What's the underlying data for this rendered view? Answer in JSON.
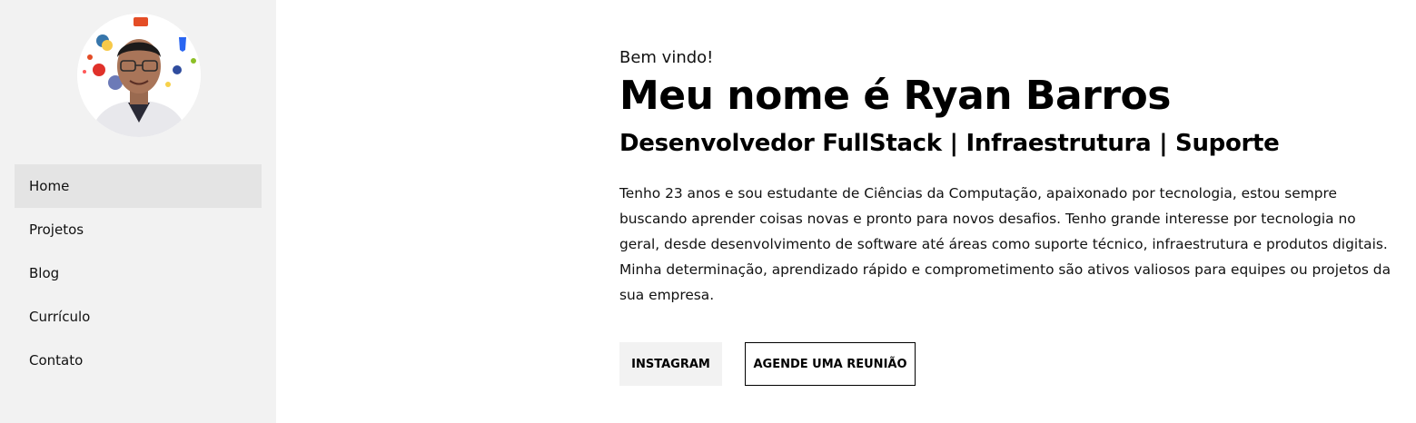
{
  "sidebar": {
    "avatar_alt": "Ryan Barros",
    "nav_items": [
      {
        "label": "Home",
        "active": true
      },
      {
        "label": "Projetos",
        "active": false
      },
      {
        "label": "Blog",
        "active": false
      },
      {
        "label": "Currículo",
        "active": false
      },
      {
        "label": "Contato",
        "active": false
      }
    ]
  },
  "hero": {
    "greeting": "Bem vindo!",
    "name": "Meu nome é Ryan Barros",
    "role": "Desenvolvedor FullStack | Infraestrutura | Suporte",
    "bio": "Tenho 23 anos e sou estudante de Ciências da Computação, apaixonado por tecnologia, estou sempre buscando aprender coisas novas e pronto para novos desafios. Tenho grande interesse por tecnologia no geral, desde desenvolvimento de software até áreas como suporte técnico, infraestrutura e produtos digitais. Minha determinação, aprendizado rápido e comprometimento são ativos valiosos para equipes ou projetos da sua empresa.",
    "buttons": {
      "instagram": "INSTAGRAM",
      "meeting": "AGENDE UMA REUNIÃO"
    }
  },
  "colors": {
    "sidebar_bg": "#f2f2f2",
    "active_item_bg": "#e4e4e4",
    "text": "#000000"
  }
}
